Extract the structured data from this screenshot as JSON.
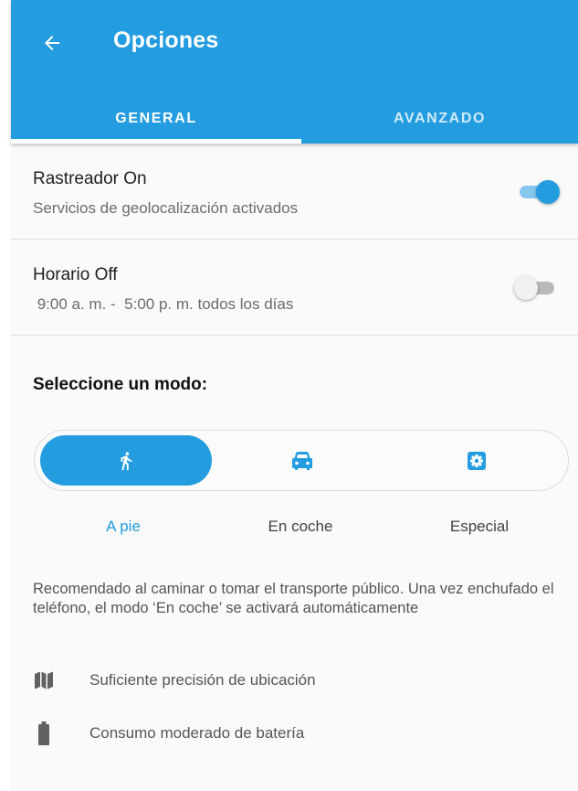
{
  "header": {
    "title": "Opciones",
    "back_icon": "arrow-left-icon",
    "background": "#239ce0"
  },
  "tabs": [
    {
      "label": "GENERAL",
      "selected": true
    },
    {
      "label": "AVANZADO",
      "selected": false
    }
  ],
  "settings": [
    {
      "title": "Rastreador On",
      "subtitle": "Servicios de geolocalización activados",
      "enabled": true
    },
    {
      "title": "Horario Off",
      "subtitle": " 9:00 a. m. -  5:00 p. m. todos los días",
      "enabled": false
    }
  ],
  "mode": {
    "heading": "Seleccione un modo:",
    "options": [
      {
        "label": "A pie",
        "icon": "walking-person-icon",
        "selected": true
      },
      {
        "label": "En coche",
        "icon": "car-icon",
        "selected": false
      },
      {
        "label": "Especial",
        "icon": "settings-gear-icon",
        "selected": false
      }
    ],
    "description": "Recomendado al caminar o tomar el transporte público. Una vez enchufado el teléfono, el modo ‘En coche’ se activará automáticamente",
    "features": [
      {
        "icon": "map-icon",
        "text": "Suficiente precisión de ubicación"
      },
      {
        "icon": "battery-icon",
        "text": "Consumo moderado de batería"
      }
    ]
  },
  "colors": {
    "accent": "#239ce0",
    "background": "#fafafa",
    "text_primary": "#212121",
    "text_secondary": "#6b6b6b"
  }
}
